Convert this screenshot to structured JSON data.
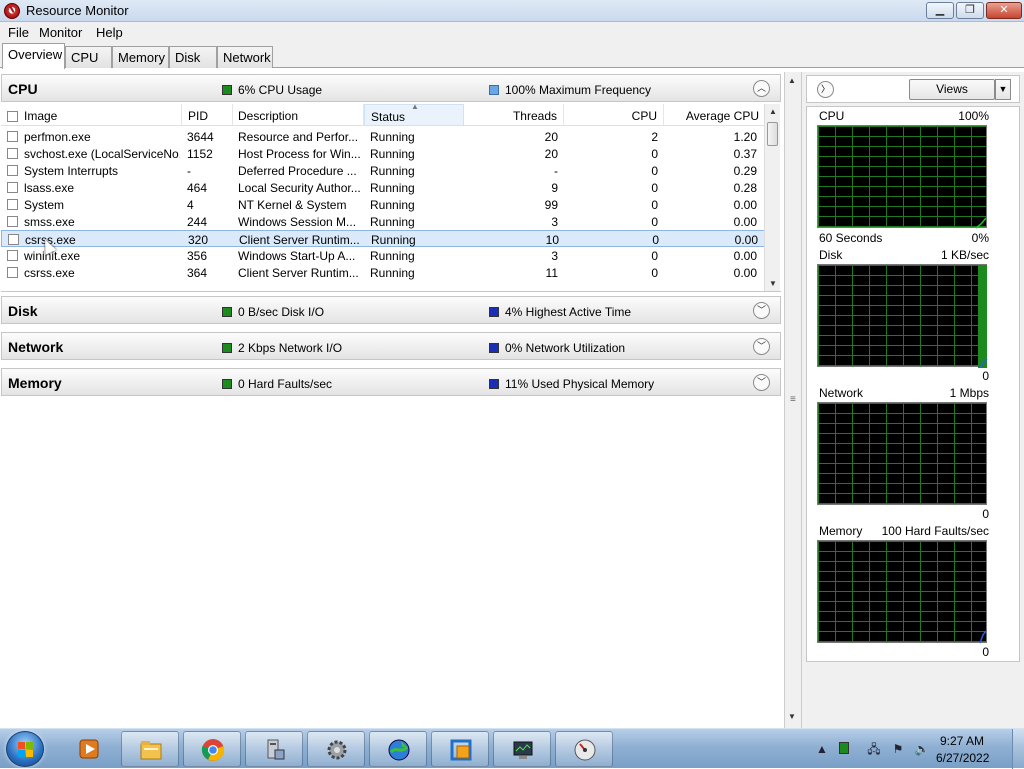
{
  "window": {
    "title": "Resource Monitor"
  },
  "menu": {
    "items": [
      "File",
      "Monitor",
      "Help"
    ]
  },
  "tabs": [
    {
      "label": "Overview",
      "active": true
    },
    {
      "label": "CPU"
    },
    {
      "label": "Memory"
    },
    {
      "label": "Disk"
    },
    {
      "label": "Network"
    }
  ],
  "sections": {
    "cpu": {
      "title": "CPU",
      "stat1": "6% CPU Usage",
      "stat2": "100% Maximum Frequency"
    },
    "disk": {
      "title": "Disk",
      "stat1": "0 B/sec Disk I/O",
      "stat2": "4% Highest Active Time"
    },
    "network": {
      "title": "Network",
      "stat1": "2 Kbps Network I/O",
      "stat2": "0% Network Utilization"
    },
    "memory": {
      "title": "Memory",
      "stat1": "0 Hard Faults/sec",
      "stat2": "11% Used Physical Memory"
    }
  },
  "cpu_table": {
    "columns": [
      "Image",
      "PID",
      "Description",
      "Status",
      "Threads",
      "CPU",
      "Average CPU"
    ],
    "rows": [
      [
        "perfmon.exe",
        "3644",
        "Resource and Perfor...",
        "Running",
        "20",
        "2",
        "1.20"
      ],
      [
        "svchost.exe (LocalServiceNo...",
        "1152",
        "Host Process for Win...",
        "Running",
        "20",
        "0",
        "0.37"
      ],
      [
        "System Interrupts",
        "-",
        "Deferred Procedure ...",
        "Running",
        "-",
        "0",
        "0.29"
      ],
      [
        "lsass.exe",
        "464",
        "Local Security Author...",
        "Running",
        "9",
        "0",
        "0.28"
      ],
      [
        "System",
        "4",
        "NT Kernel & System",
        "Running",
        "99",
        "0",
        "0.00"
      ],
      [
        "smss.exe",
        "244",
        "Windows Session M...",
        "Running",
        "3",
        "0",
        "0.00"
      ],
      [
        "csrss.exe",
        "320",
        "Client Server Runtim...",
        "Running",
        "10",
        "0",
        "0.00"
      ],
      [
        "wininit.exe",
        "356",
        "Windows Start-Up A...",
        "Running",
        "3",
        "0",
        "0.00"
      ],
      [
        "csrss.exe",
        "364",
        "Client Server Runtim...",
        "Running",
        "11",
        "0",
        "0.00"
      ]
    ],
    "selected_row": 6
  },
  "right_pane": {
    "views_label": "Views",
    "graphs": [
      {
        "name": "CPU",
        "max": "100%",
        "footer_left": "60 Seconds",
        "footer_right": "0%"
      },
      {
        "name": "Disk",
        "max": "1 KB/sec",
        "footer_right": "0"
      },
      {
        "name": "Network",
        "max": "1 Mbps",
        "footer_right": "0"
      },
      {
        "name": "Memory",
        "max": "100 Hard Faults/sec",
        "footer_right": "0"
      }
    ]
  },
  "taskbar": {
    "apps": [
      "media-player-icon",
      "explorer-icon",
      "chrome-icon",
      "server-manager-icon",
      "settings-gear-icon",
      "network-globe-icon",
      "virtualbox-icon",
      "computer-management-icon",
      "resource-monitor-icon"
    ],
    "clock_time": "9:27 AM",
    "clock_date": "6/27/2022"
  },
  "colors": {
    "graph_grid": "#1f7a1f",
    "graph_line": "#22c422",
    "selected_row": "#dbeafb"
  }
}
